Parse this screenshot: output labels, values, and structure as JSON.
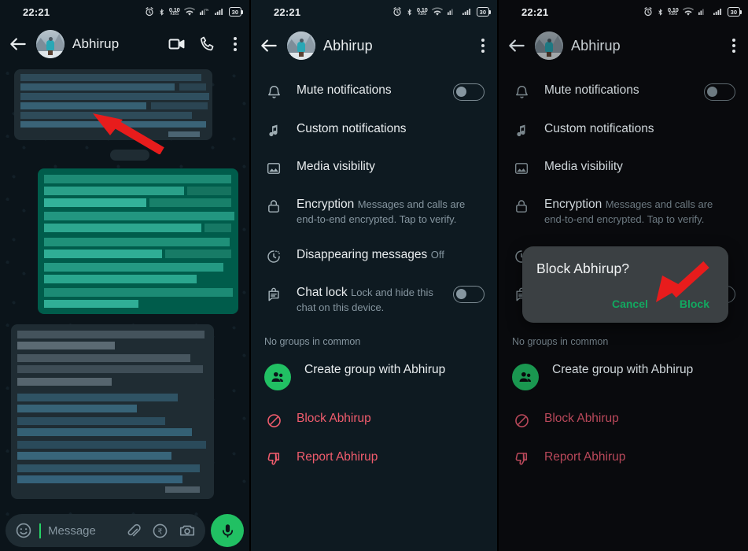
{
  "status_bar": {
    "time": "22:21",
    "icons": [
      "alarm-icon",
      "bluetooth-icon",
      "network-speed-icon",
      "wifi-icon",
      "sim-signal-icon",
      "cellular-signal-icon",
      "battery-icon"
    ],
    "network_speed_value": "0.10",
    "network_speed_unit": "KB/S",
    "battery_level": "30"
  },
  "panel1": {
    "name": "whatsapp-chat-screen",
    "header": {
      "title": "Abhirup",
      "back_icon": "back-arrow-icon",
      "avatar": "contact-avatar",
      "video_call_icon": "video-call-icon",
      "voice_call_icon": "voice-call-icon",
      "overflow_icon": "overflow-menu-icon"
    },
    "composer": {
      "emoji_icon": "emoji-icon",
      "placeholder": "Message",
      "attach_icon": "attachment-clip-icon",
      "payment_icon": "rupee-payment-icon",
      "camera_icon": "camera-icon",
      "mic_icon": "microphone-icon"
    },
    "annotation": {
      "arrow": "red-arrow-pointing-to-contact-name"
    }
  },
  "panel2": {
    "name": "contact-info-screen",
    "header": {
      "title": "Abhirup",
      "back_icon": "back-arrow-icon",
      "avatar": "contact-avatar",
      "overflow_icon": "overflow-menu-icon"
    },
    "rows": [
      {
        "icon": "bell-icon",
        "label": "Mute notifications",
        "sub": "",
        "toggle": "off"
      },
      {
        "icon": "music-note-icon",
        "label": "Custom notifications",
        "sub": "",
        "toggle": ""
      },
      {
        "icon": "image-icon",
        "label": "Media visibility",
        "sub": "",
        "toggle": ""
      },
      {
        "icon": "lock-icon",
        "label": "Encryption",
        "sub": "Messages and calls are end-to-end encrypted. Tap to verify.",
        "toggle": ""
      },
      {
        "icon": "timer-icon",
        "label": "Disappearing messages",
        "sub": "Off",
        "toggle": ""
      },
      {
        "icon": "chat-lock-icon",
        "label": "Chat lock",
        "sub": "Lock and hide this chat on this device.",
        "toggle": "off"
      }
    ],
    "section_header": "No groups in common",
    "actions": [
      {
        "icon": "create-group-icon",
        "label": "Create group with Abhirup",
        "style": "normal"
      },
      {
        "icon": "block-icon",
        "label": "Block Abhirup",
        "style": "danger"
      },
      {
        "icon": "report-icon",
        "label": "Report Abhirup",
        "style": "danger"
      }
    ],
    "annotation": {
      "arrow": "red-arrow-pointing-to-block-abhirup"
    }
  },
  "panel3": {
    "name": "contact-info-screen-with-block-dialog",
    "header": {
      "title": "Abhirup",
      "back_icon": "back-arrow-icon",
      "avatar": "contact-avatar",
      "overflow_icon": "overflow-menu-icon"
    },
    "dialog": {
      "title": "Block Abhirup?",
      "cancel_label": "Cancel",
      "confirm_label": "Block"
    },
    "annotation": {
      "arrow": "red-arrow-pointing-to-block-button"
    }
  },
  "colors": {
    "chat_background": "#0b141a",
    "info_background": "#0e1a21",
    "dimmed_background": "#090a0d",
    "outgoing_bubble": "#005c4b",
    "incoming_bubble": "#1f2c33",
    "accent_green": "#21c063",
    "dialog_green": "#12a860",
    "danger_red": "#f15c6d",
    "annotation_red": "#e81c1c",
    "primary_text": "#e9edef",
    "secondary_text": "#8696a0",
    "dialog_background": "#3b4043"
  }
}
